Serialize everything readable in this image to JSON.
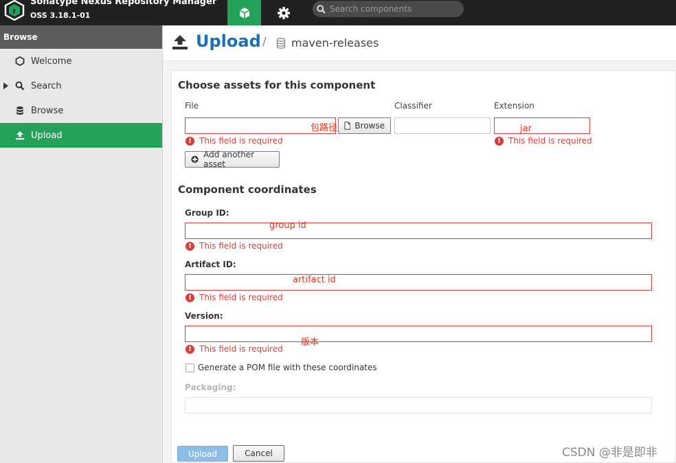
{
  "header": {
    "app_name": "Sonatype Nexus Repository Manager",
    "version": "OSS 3.18.1-01",
    "search_placeholder": "Search components"
  },
  "sidebar": {
    "heading": "Browse",
    "items": [
      {
        "label": "Welcome",
        "icon": "hexagon-icon"
      },
      {
        "label": "Search",
        "icon": "search-icon"
      },
      {
        "label": "Browse",
        "icon": "database-icon"
      },
      {
        "label": "Upload",
        "icon": "upload-icon"
      }
    ]
  },
  "page": {
    "title": "Upload",
    "separator": "/",
    "repository": "maven-releases"
  },
  "assets": {
    "heading": "Choose assets for this component",
    "file_label": "File",
    "classifier_label": "Classifier",
    "extension_label": "Extension",
    "file_value": "包路径",
    "browse_label": "Browse",
    "extension_value": "jar",
    "required_msg": "This field is required",
    "add_asset_label": "Add another asset"
  },
  "coordinates": {
    "heading": "Component coordinates",
    "group_label": "Group ID:",
    "group_value": "group id",
    "artifact_label": "Artifact ID:",
    "artifact_value": "artifact id",
    "version_label": "Version:",
    "version_value": "版本",
    "required_msg": "This field is required",
    "pom_label": "Generate a POM file with these coordinates",
    "packaging_label": "Packaging:"
  },
  "actions": {
    "upload_label": "Upload",
    "cancel_label": "Cancel"
  },
  "watermark": "CSDN @非是即非"
}
